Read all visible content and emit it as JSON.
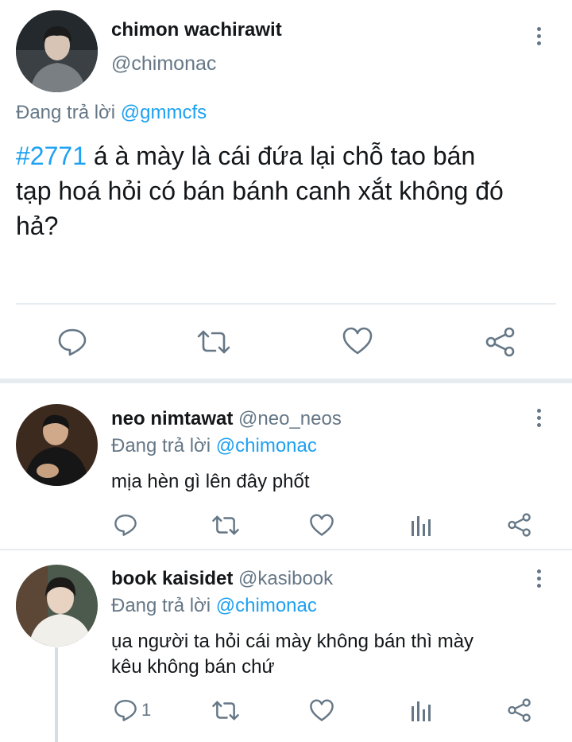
{
  "main_tweet": {
    "display_name": "chimon wachirawit",
    "handle": "@chimonac",
    "replying_prefix": "Đang trả lời",
    "replying_to": "@gmmcfs",
    "hashtag": "#2771",
    "text_line1": " á à mày là cái đứa lại chỗ tao bán",
    "text_line2": "tạp hoá hỏi có bán bánh canh xắt không đó",
    "text_line3": "hả?",
    "icons": [
      "reply-icon",
      "retweet-icon",
      "like-icon",
      "share-icon"
    ]
  },
  "replies": [
    {
      "display_name": "neo nimtawat",
      "handle": "@neo_neos",
      "replying_prefix": "Đang trả lời",
      "replying_to": "@chimonac",
      "text_line1": "mịa hèn gì lên đây phốt",
      "text_line2": "",
      "reply_count": ""
    },
    {
      "display_name": "book kaisidet",
      "handle": "@kasibook",
      "replying_prefix": "Đang trả lời",
      "replying_to": "@chimonac",
      "text_line1": "ụa người ta hỏi cái mày không bán thì mày",
      "text_line2": "kêu không bán chứ",
      "reply_count": "1"
    }
  ],
  "colors": {
    "accent": "#1da1f2",
    "secondary_text": "#657786",
    "divider": "#e6ecf0"
  }
}
